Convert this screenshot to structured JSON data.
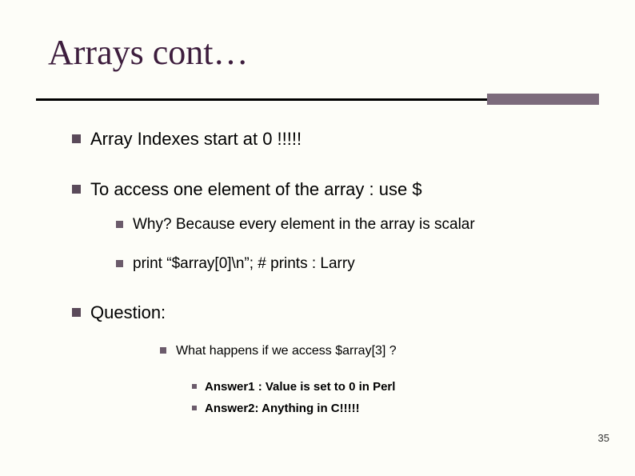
{
  "slide": {
    "title": "Arrays cont…",
    "page_number": "35"
  },
  "bullets": {
    "l1_a": "Array Indexes start at 0 !!!!!",
    "l1_b": "To access one element of the array : use $",
    "l2_a": "Why? Because every element in the array is scalar",
    "l2_b": "print “$array[0]\\n”;  #  prints : Larry",
    "l1_c": "Question:",
    "l3_a": "What happens if we access $array[3] ?",
    "l4_a": "Answer1 : Value is set to 0 in Perl",
    "l4_b": "Answer2:  Anything in C!!!!!"
  }
}
